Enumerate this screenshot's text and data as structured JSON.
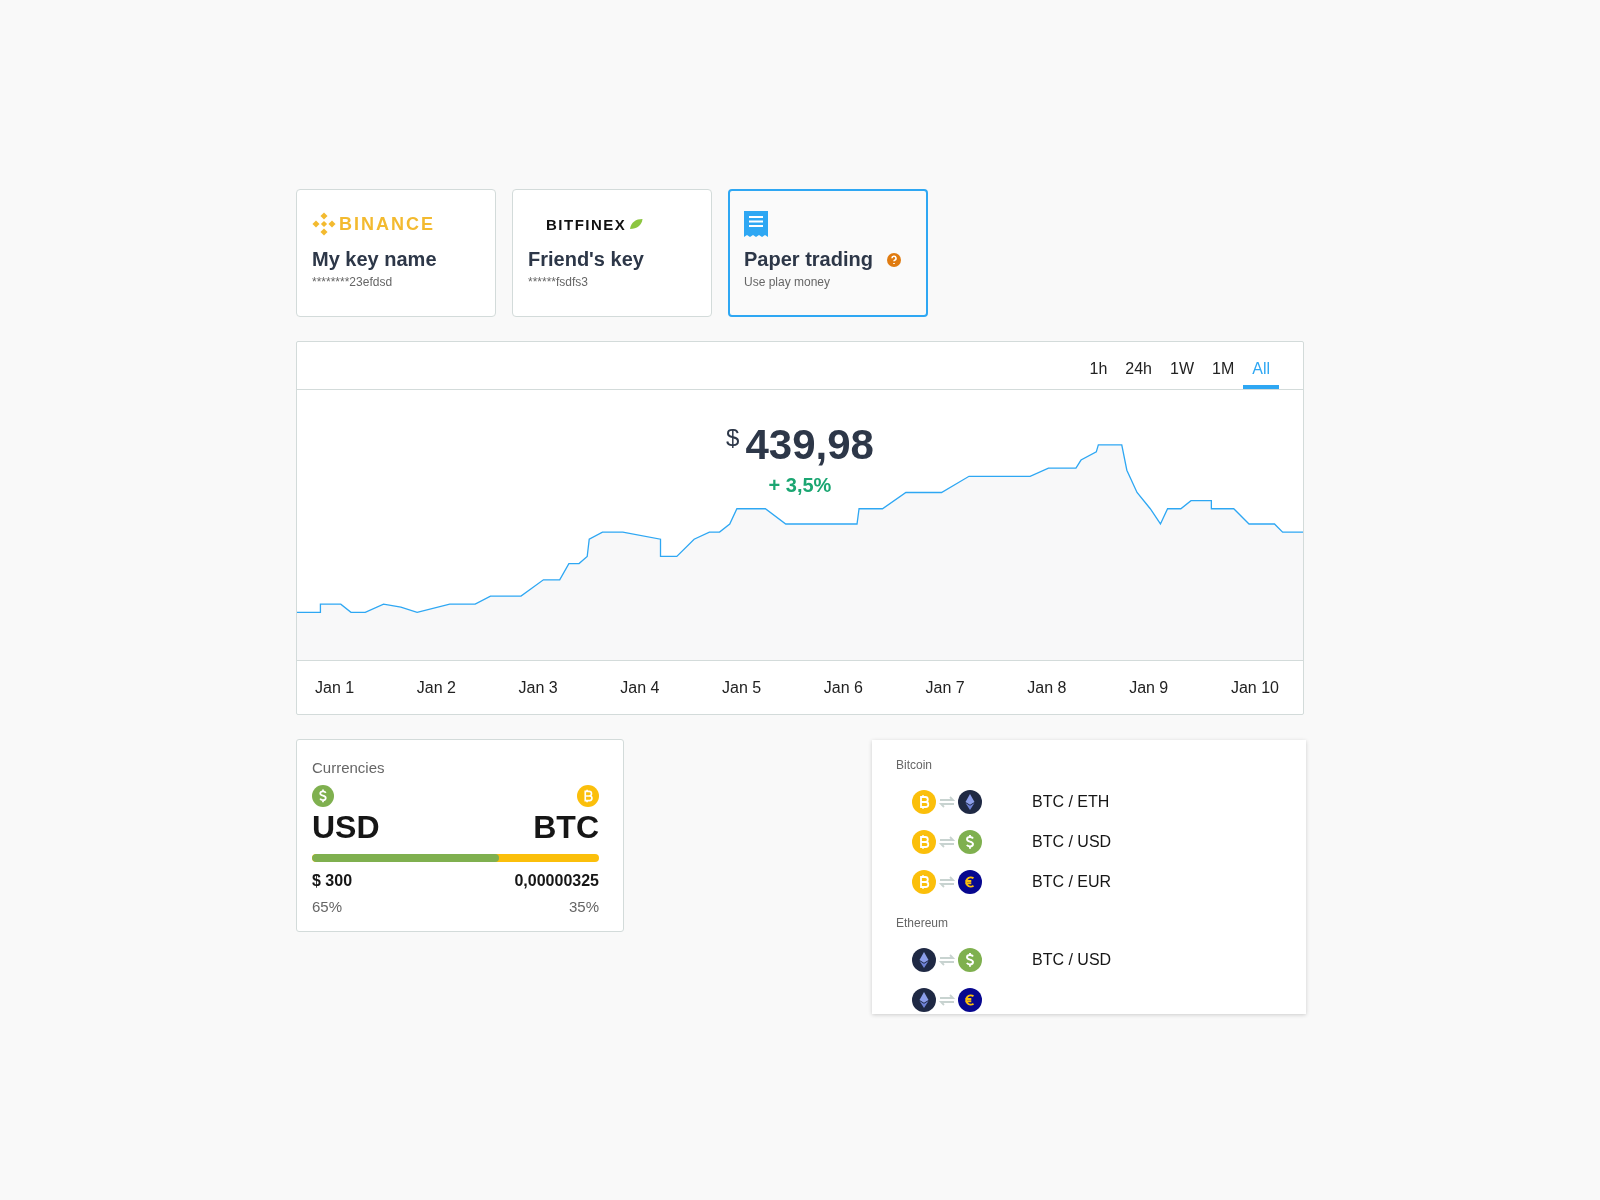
{
  "accounts": [
    {
      "logo": {
        "kind": "binance",
        "text": "BINANCE"
      },
      "name": "My key name",
      "subtitle": "********23efdsd",
      "help": false,
      "selected": false
    },
    {
      "logo": {
        "kind": "bitfinex",
        "text": "BITFINEX"
      },
      "name": "Friend's key",
      "subtitle": "******fsdfs3",
      "help": false,
      "selected": false
    },
    {
      "logo": {
        "kind": "paper"
      },
      "name": "Paper trading",
      "subtitle": "Use play money",
      "help": true,
      "selected": true
    }
  ],
  "chart": {
    "ranges": [
      {
        "label": "1h",
        "selected": false
      },
      {
        "label": "24h",
        "selected": false
      },
      {
        "label": "1W",
        "selected": false
      },
      {
        "label": "1M",
        "selected": false
      },
      {
        "label": "All",
        "selected": true
      }
    ],
    "currency_symbol": "$",
    "value": "439,98",
    "change": "+ 3,5%",
    "x_labels": [
      "Jan 1",
      "Jan 2",
      "Jan 3",
      "Jan 4",
      "Jan 5",
      "Jan 6",
      "Jan 7",
      "Jan 8",
      "Jan 9",
      "Jan 10"
    ]
  },
  "currencies": {
    "title": "Currencies",
    "left": {
      "coin": {
        "kind": "usd"
      },
      "code": "USD",
      "amount": "$ 300",
      "share": "65%"
    },
    "right": {
      "coin": {
        "kind": "btc"
      },
      "code": "BTC",
      "amount": "0,00000325",
      "share": "35%"
    },
    "level": 0.65
  },
  "pairs": [
    {
      "title": "Bitcoin",
      "items": [
        {
          "from": {
            "kind": "btc"
          },
          "to": {
            "kind": "eth"
          },
          "label": "BTC / ETH"
        },
        {
          "from": {
            "kind": "btc"
          },
          "to": {
            "kind": "usd"
          },
          "label": "BTC / USD"
        },
        {
          "from": {
            "kind": "btc"
          },
          "to": {
            "kind": "eur"
          },
          "label": "BTC / EUR"
        }
      ]
    },
    {
      "title": "Ethereum",
      "items": [
        {
          "from": {
            "kind": "eth"
          },
          "to": {
            "kind": "usd"
          },
          "label": "BTC / USD"
        },
        {
          "from": {
            "kind": "eth"
          },
          "to": {
            "kind": "eur"
          }
        }
      ]
    }
  ]
}
